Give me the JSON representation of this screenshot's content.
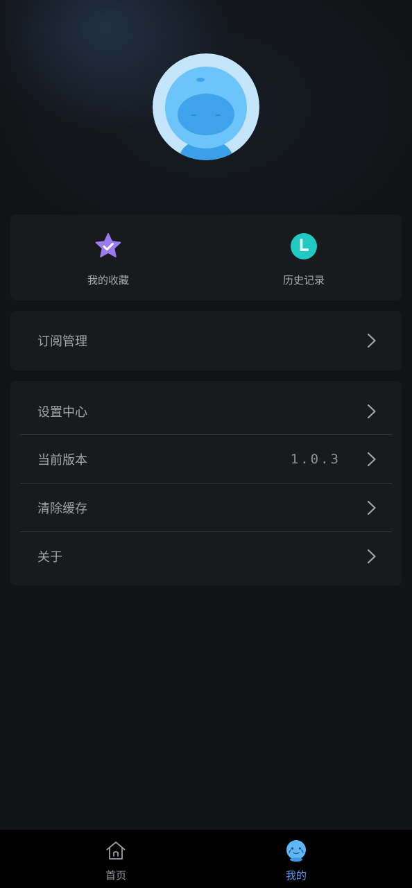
{
  "quick_actions": [
    {
      "label": "我的收藏",
      "icon": "star-check-icon",
      "color": "#9b7bf0"
    },
    {
      "label": "历史记录",
      "icon": "clock-icon",
      "color": "#20c9c4"
    }
  ],
  "subscription": {
    "label": "订阅管理"
  },
  "settings_list": [
    {
      "label": "设置中心"
    },
    {
      "label": "当前版本",
      "value": "1.0.3"
    },
    {
      "label": "清除缓存"
    },
    {
      "label": "关于"
    }
  ],
  "tabbar": {
    "items": [
      {
        "label": "首页",
        "icon": "home-icon",
        "active": false
      },
      {
        "label": "我的",
        "icon": "mascot-face-icon",
        "active": true
      }
    ],
    "active_color": "#5a9df0",
    "inactive_color": "#9a9da2"
  },
  "colors": {
    "background": "#111316",
    "card": "#181a1e",
    "avatar_light": "#bfe3fb",
    "avatar_blue": "#42a6ee"
  }
}
